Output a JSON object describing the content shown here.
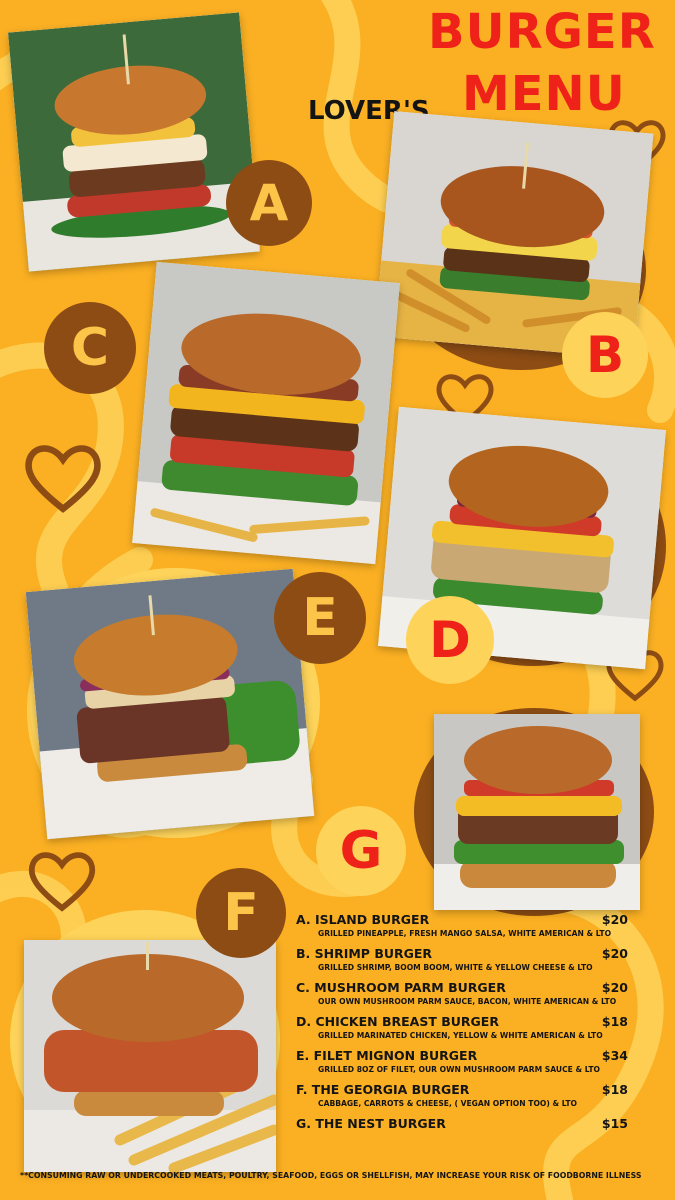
{
  "title": {
    "line1": "BURGER",
    "lovers": "LOVER'S",
    "line2": "MENU"
  },
  "colors": {
    "background": "#fbb023",
    "accent_red": "#ef2219",
    "brown": "#8c4c14",
    "light_yellow": "#fdd35a"
  },
  "letters": {
    "a": "A",
    "b": "B",
    "c": "C",
    "d": "D",
    "e": "E",
    "f": "F",
    "g": "G"
  },
  "photos": [
    {
      "letter": "A",
      "name": "Island Burger"
    },
    {
      "letter": "B",
      "name": "Shrimp Burger"
    },
    {
      "letter": "C",
      "name": "Mushroom Parm Burger"
    },
    {
      "letter": "D",
      "name": "Chicken Breast Burger"
    },
    {
      "letter": "E",
      "name": "Filet Mignon Burger"
    },
    {
      "letter": "F",
      "name": "The Georgia Burger"
    },
    {
      "letter": "G",
      "name": "The Nest Burger"
    }
  ],
  "menu": {
    "items": [
      {
        "name": "A. ISLAND BURGER",
        "price": "$20",
        "desc": "GRILLED PINEAPPLE, FRESH MANGO SALSA, WHITE AMERICAN & LTO"
      },
      {
        "name": "B. SHRIMP BURGER",
        "price": "$20",
        "desc": "GRILLED SHRIMP, BOOM BOOM, WHITE & YELLOW CHEESE & LTO"
      },
      {
        "name": "C. MUSHROOM PARM BURGER",
        "price": "$20",
        "desc": "OUR OWN MUSHROOM PARM SAUCE, BACON, WHITE AMERICAN & LTO"
      },
      {
        "name": "D. CHICKEN BREAST BURGER",
        "price": "$18",
        "desc": "GRILLED MARINATED CHICKEN, YELLOW & WHITE AMERICAN & LTO"
      },
      {
        "name": "E. FILET MIGNON BURGER",
        "price": "$34",
        "desc": "GRILLED 8OZ OF FILET, OUR OWN MUSHROOM PARM SAUCE & LTO"
      },
      {
        "name": "F. THE GEORGIA BURGER",
        "price": "$18",
        "desc": "CABBAGE, CARROTS & CHEESE, ( VEGAN OPTION TOO) & LTO"
      },
      {
        "name": "G. THE NEST BURGER",
        "price": "$15",
        "desc": ""
      }
    ]
  },
  "disclaimer": "**CONSUMING RAW OR UNDERCOOKED MEATS, POULTRY, SEAFOOD, EGGS OR SHELLFISH, MAY INCREASE YOUR RISK OF FOODBORNE ILLNESS"
}
